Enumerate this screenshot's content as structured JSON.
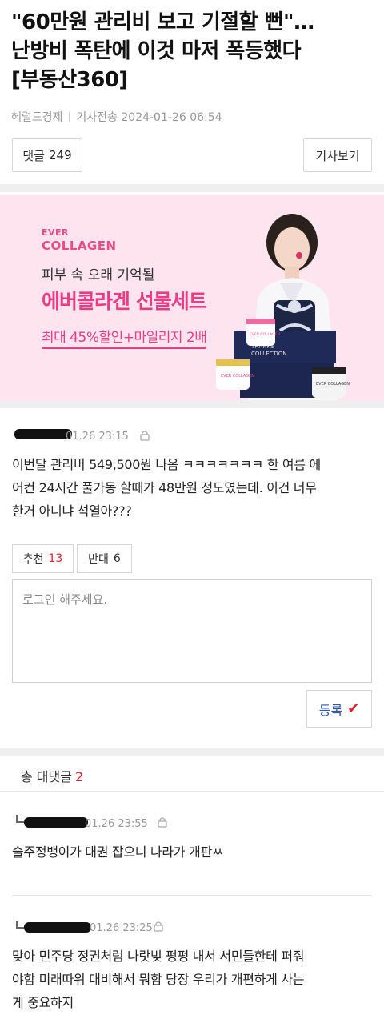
{
  "article": {
    "title_line1": "\"60만원 관리비 보고 기절할 뻔\"…",
    "title_line2": "난방비 폭탄에 이것 마저 폭등했다",
    "title_line3": "[부동산360]",
    "source": "헤럴드경제",
    "byline": "기사전송 2024-01-26 06:54"
  },
  "toolbar": {
    "comments_label": "댓글",
    "comments_count": "249",
    "view_article_label": "기사보기"
  },
  "ad": {
    "logo_top": "EVER",
    "logo_bottom": "COLLAGEN",
    "subtitle": "피부 속 오래 기억될",
    "headline": "에버콜라겐 선물세트",
    "offer": "최대 45%할인+마일리지 2배",
    "box_text_1": "THANKS",
    "box_text_2": "COLLECTION",
    "jar_label_1": "EVER COLLAGEN",
    "jar_label_2": "EVER COLLAGEN",
    "jar_label_3": "EVER COLLAGEN",
    "colors": {
      "background": "#fde4ee",
      "accent": "#ec3c86"
    }
  },
  "comment": {
    "time": "01.26 23:15",
    "text_line1": "이번달 관리비 549,500원 나옴 ㅋㅋㅋㅋㅋㅋㅋ 한 여름 에",
    "text_line2": "어컨 24시간 풀가동 할때가 48만원 정도였는데. 이건 너무",
    "text_line3": "한거 아니냐 석열아???",
    "upvote_label": "추천",
    "upvote_count": "13",
    "downvote_label": "반대",
    "downvote_count": "6",
    "reply_placeholder": "로그인 해주세요.",
    "submit_label": "등록"
  },
  "replies": {
    "header_label": "총 대댓글",
    "count": "2",
    "items": [
      {
        "time": "01.26 23:55",
        "text_line1": "술주정뱅이가 대권 잡으니 나라가 개판ㅆ"
      },
      {
        "time": "01.26 23:25",
        "text_line1": "맞아 민주당 정권처럼 나랏빚 펑펑 내서 서민들한테 퍼줘",
        "text_line2": "야함 미래따위 대비해서 뭐함 당장 우리가 개편하게 사는",
        "text_line3": "게 중요하지"
      }
    ]
  }
}
